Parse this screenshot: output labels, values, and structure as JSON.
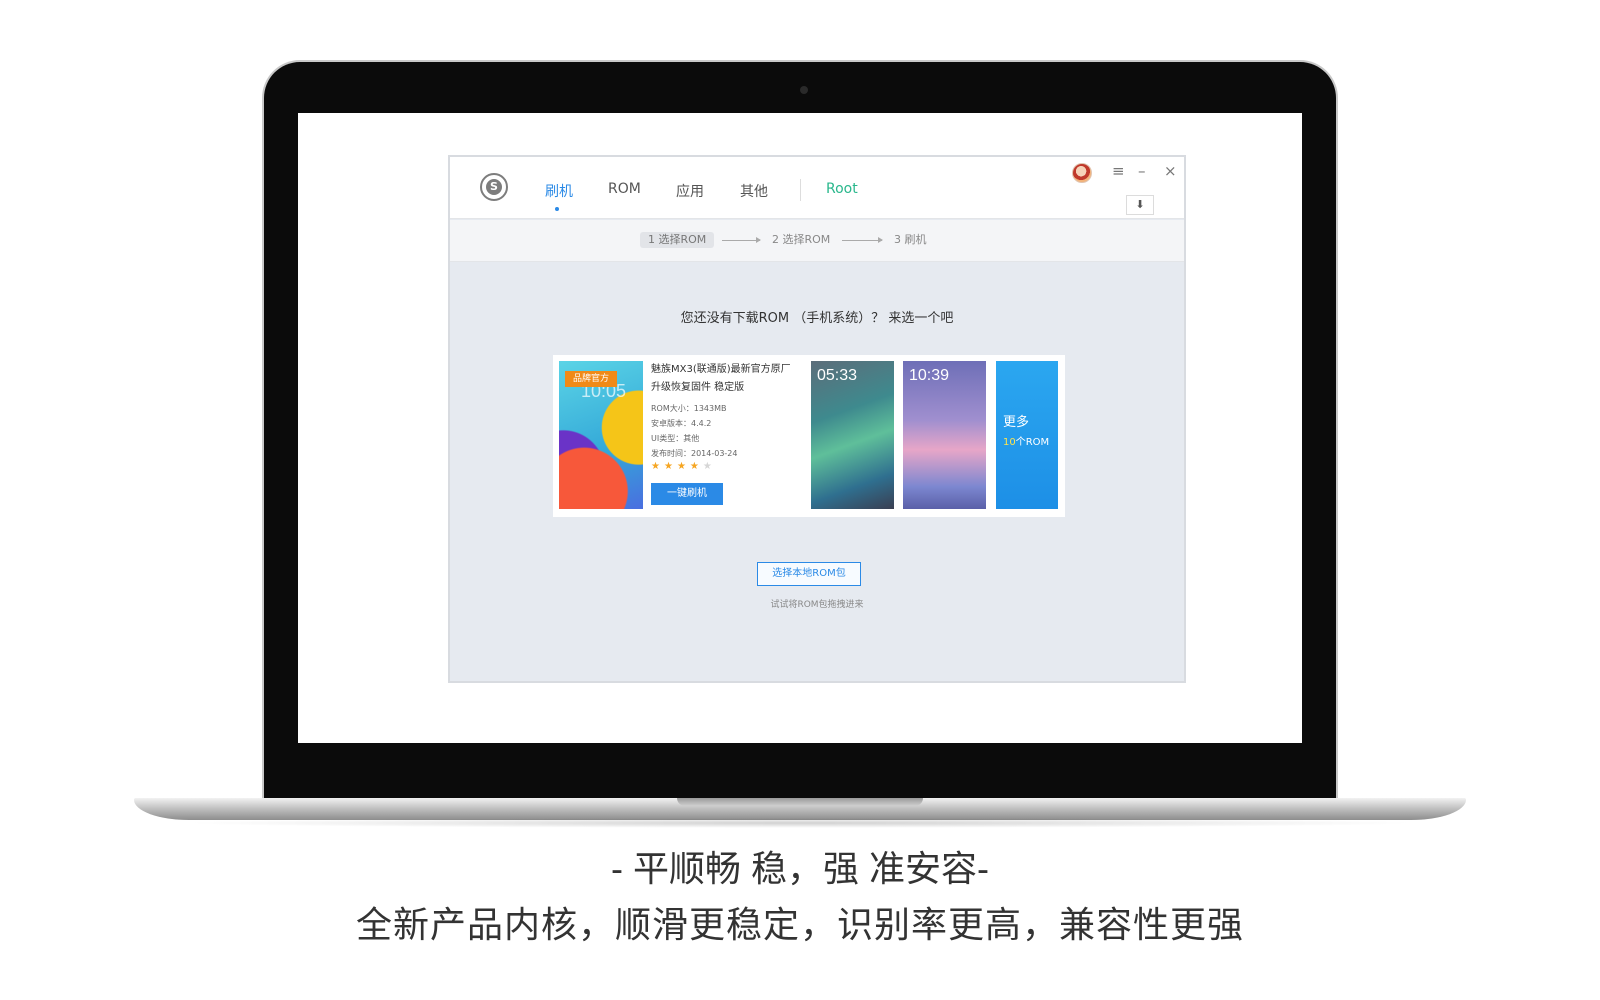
{
  "app": {
    "tabs": {
      "flash": "刷机",
      "rom": "ROM",
      "apps": "应用",
      "other": "其他",
      "root": "Root"
    },
    "window_controls": {
      "menu": "≡",
      "minimize": "–",
      "close": "×",
      "download": "⬇"
    },
    "steps": {
      "step1": "1 选择ROM",
      "step2": "2 选择ROM",
      "step3": "3 刷机"
    },
    "prompt": "您还没有下载ROM （手机系统）？ 来选一个吧",
    "featured_rom": {
      "badge": "品牌官方",
      "thumb_clock": "10:05",
      "title_line1": "魅族MX3(联通版)最新官方原厂",
      "title_line2": "升级恢复固件 稳定版",
      "size": "ROM大小：1343MB",
      "android_version": "安卓版本：4.4.2",
      "ui_type": "UI类型：其他",
      "release_date": "发布时间：2014-03-24",
      "rating_stars": 4,
      "flash_button": "一键刷机"
    },
    "screenshots": {
      "shot1_time": "05:33",
      "shot2_time": "10:39"
    },
    "more": {
      "title": "更多",
      "count": "10",
      "unit": "个ROM"
    },
    "local_rom_button": "选择本地ROM包",
    "drag_hint": "试试将ROM包拖拽进来"
  },
  "captions": {
    "tagline": "- 平顺畅 稳，强 准安容-",
    "description": "全新产品内核，顺滑更稳定，识别率更高，兼容性更强"
  },
  "colors": {
    "accent": "#2b8ae6",
    "root_green": "#29b78c",
    "badge_orange": "#f08a17",
    "star": "#f6a623"
  }
}
